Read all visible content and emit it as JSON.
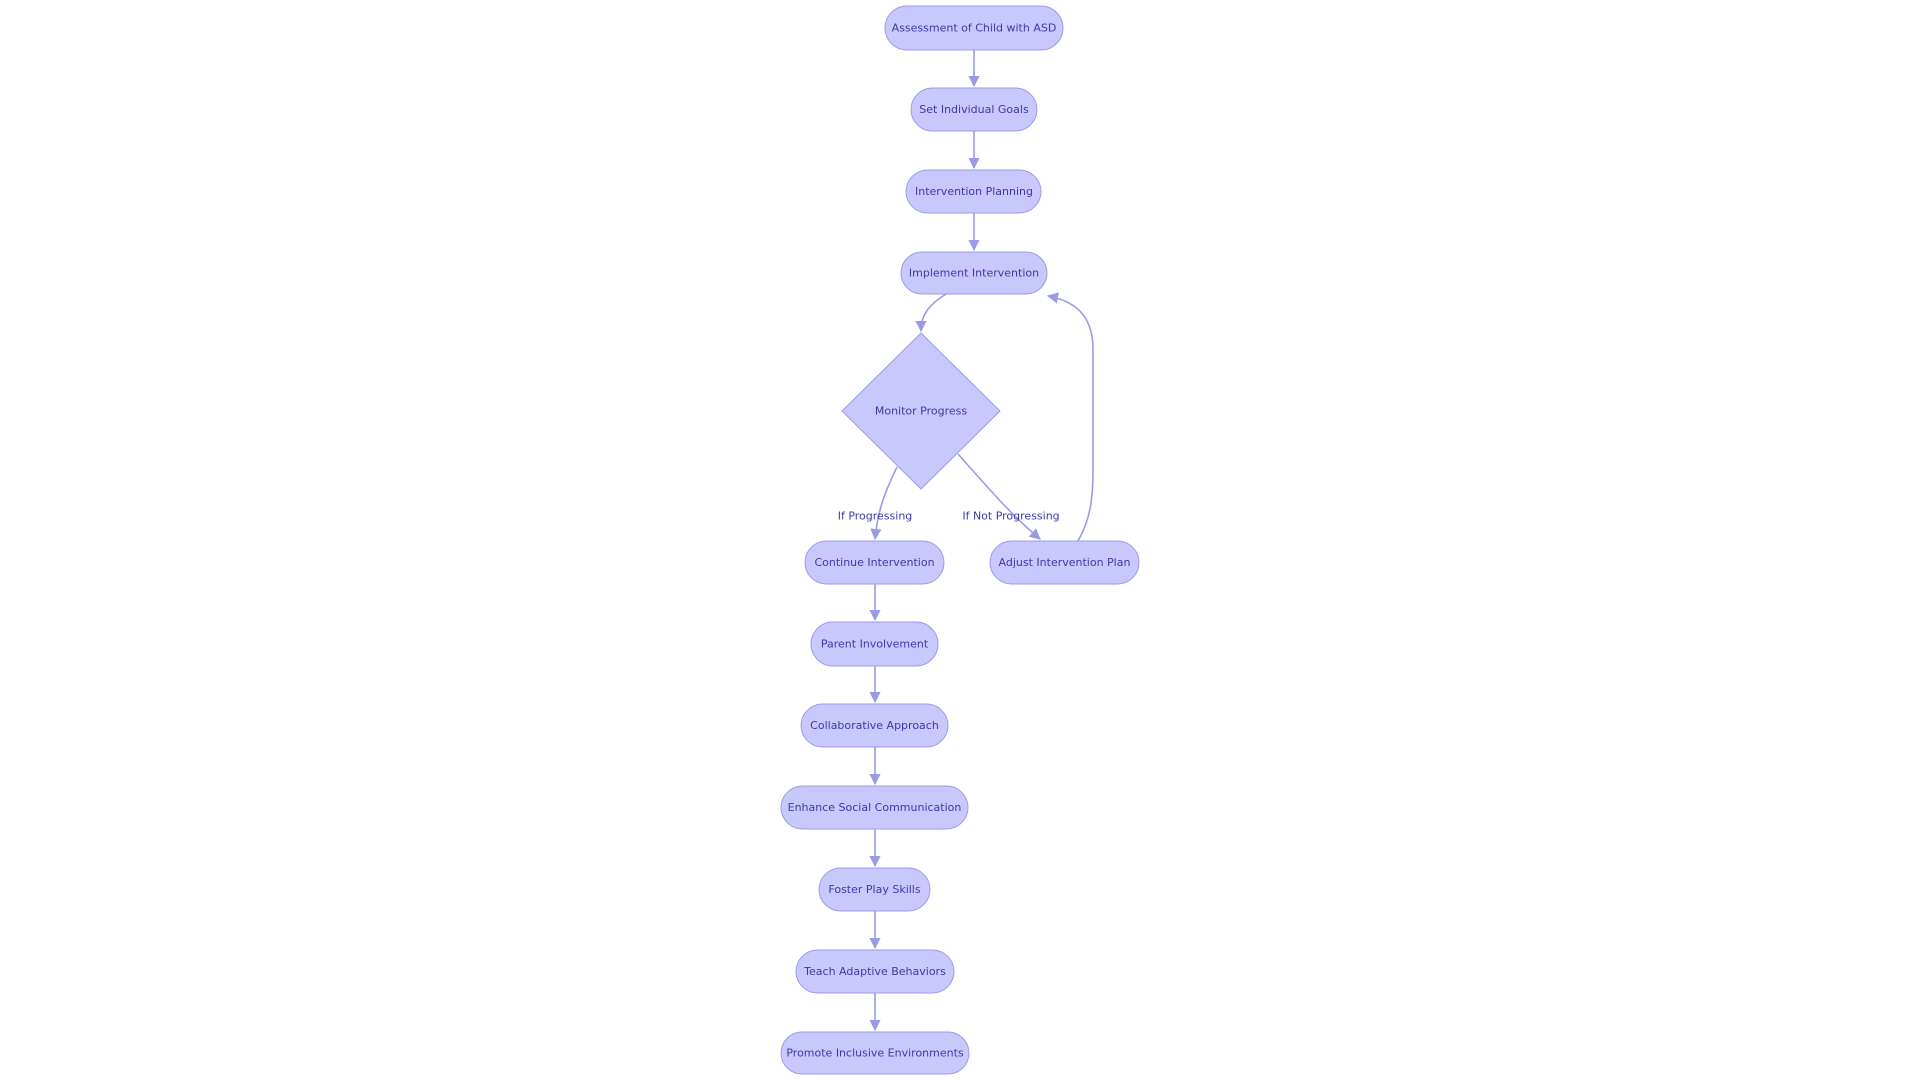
{
  "diagram": {
    "type": "flowchart",
    "colors": {
      "node_fill": "#c8c8fd",
      "node_stroke": "#9c9ce6",
      "text": "#3b3ba6",
      "edge": "#9a9ae6",
      "background": "#ffffff"
    },
    "nodes": [
      {
        "id": "assessment",
        "label": "Assessment of Child with ASD",
        "shape": "rounded"
      },
      {
        "id": "goals",
        "label": "Set Individual Goals",
        "shape": "rounded"
      },
      {
        "id": "planning",
        "label": "Intervention Planning",
        "shape": "rounded"
      },
      {
        "id": "implement",
        "label": "Implement Intervention",
        "shape": "rounded"
      },
      {
        "id": "monitor",
        "label": "Monitor Progress",
        "shape": "diamond"
      },
      {
        "id": "continue",
        "label": "Continue Intervention",
        "shape": "rounded"
      },
      {
        "id": "adjust",
        "label": "Adjust Intervention Plan",
        "shape": "rounded"
      },
      {
        "id": "parent",
        "label": "Parent Involvement",
        "shape": "rounded"
      },
      {
        "id": "collab",
        "label": "Collaborative Approach",
        "shape": "rounded"
      },
      {
        "id": "social",
        "label": "Enhance Social Communication",
        "shape": "rounded"
      },
      {
        "id": "play",
        "label": "Foster Play Skills",
        "shape": "rounded"
      },
      {
        "id": "adaptive",
        "label": "Teach Adaptive Behaviors",
        "shape": "rounded"
      },
      {
        "id": "inclusive",
        "label": "Promote Inclusive Environments",
        "shape": "rounded"
      }
    ],
    "edges": [
      {
        "from": "assessment",
        "to": "goals",
        "label": ""
      },
      {
        "from": "goals",
        "to": "planning",
        "label": ""
      },
      {
        "from": "planning",
        "to": "implement",
        "label": ""
      },
      {
        "from": "implement",
        "to": "monitor",
        "label": ""
      },
      {
        "from": "monitor",
        "to": "continue",
        "label": "If Progressing"
      },
      {
        "from": "monitor",
        "to": "adjust",
        "label": "If Not Progressing"
      },
      {
        "from": "adjust",
        "to": "implement",
        "label": ""
      },
      {
        "from": "continue",
        "to": "parent",
        "label": ""
      },
      {
        "from": "parent",
        "to": "collab",
        "label": ""
      },
      {
        "from": "collab",
        "to": "social",
        "label": ""
      },
      {
        "from": "social",
        "to": "play",
        "label": ""
      },
      {
        "from": "play",
        "to": "adaptive",
        "label": ""
      },
      {
        "from": "adaptive",
        "to": "inclusive",
        "label": ""
      }
    ]
  }
}
